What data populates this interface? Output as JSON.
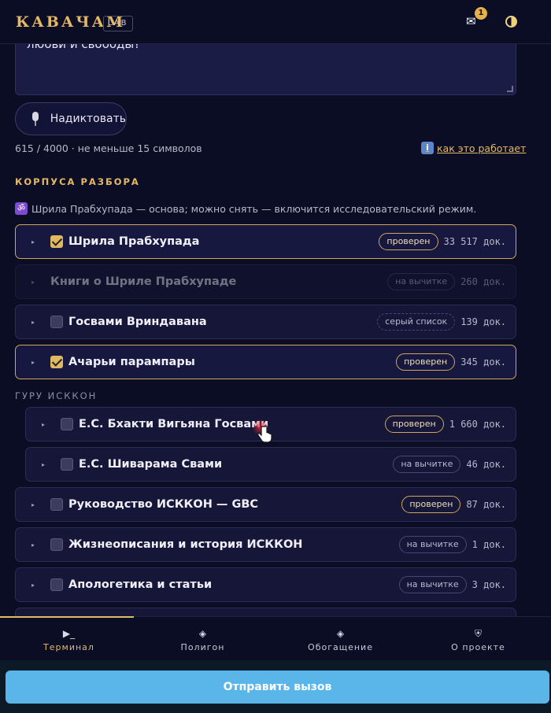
{
  "header": {
    "logo": "КАВАЧАМ",
    "lab_badge": "LAB",
    "mail_icon": "✉",
    "mail_count": "1"
  },
  "form": {
    "textarea_value": "любви и свободы?",
    "dictate_label": "Надиктовать",
    "counter": "615 / 4000 · не меньше 15 символов",
    "how_label": "как это работает"
  },
  "corpora": {
    "title": "КОРПУСА РАЗБОРА",
    "hint": "Шрила Прабхупада — основа; можно снять — включится исследовательский режим.",
    "group_label": "ГУРУ ИСККОН",
    "items": [
      {
        "name": "Шрила Прабхупада",
        "badge": "проверен",
        "count": "33 517 док."
      },
      {
        "name": "Книги о Шриле Прабхупаде",
        "badge": "на вычитке",
        "count": "260 док."
      },
      {
        "name": "Госвами Вриндавана",
        "badge": "серый список",
        "count": "139 док."
      },
      {
        "name": "Ачарьи парампары",
        "badge": "проверен",
        "count": "345 док."
      },
      {
        "name": "Е.С. Бхакти Вигьяна Госвами",
        "badge": "проверен",
        "count": "1 660 док."
      },
      {
        "name": "Е.С. Шиварама Свами",
        "badge": "на вычитке",
        "count": "46 док."
      },
      {
        "name": "Руководство ИСККОН — GBC",
        "badge": "проверен",
        "count": "87 док."
      },
      {
        "name": "Жизнеописания и история ИСККОН",
        "badge": "на вычитке",
        "count": "1 док."
      },
      {
        "name": "Апологетика и статьи",
        "badge": "на вычитке",
        "count": "3 док."
      }
    ]
  },
  "nav": {
    "tabs": [
      {
        "icon": "▶_",
        "label": "Терминал"
      },
      {
        "icon": "◈",
        "label": "Полигон"
      },
      {
        "icon": "◈",
        "label": "Обогащение"
      },
      {
        "icon": "⛨",
        "label": "О проекте"
      }
    ]
  },
  "submit_label": "Отправить вызов",
  "colors": {
    "accent": "#e5b865",
    "background": "#0b0d24",
    "submit": "#5ab6e8"
  }
}
